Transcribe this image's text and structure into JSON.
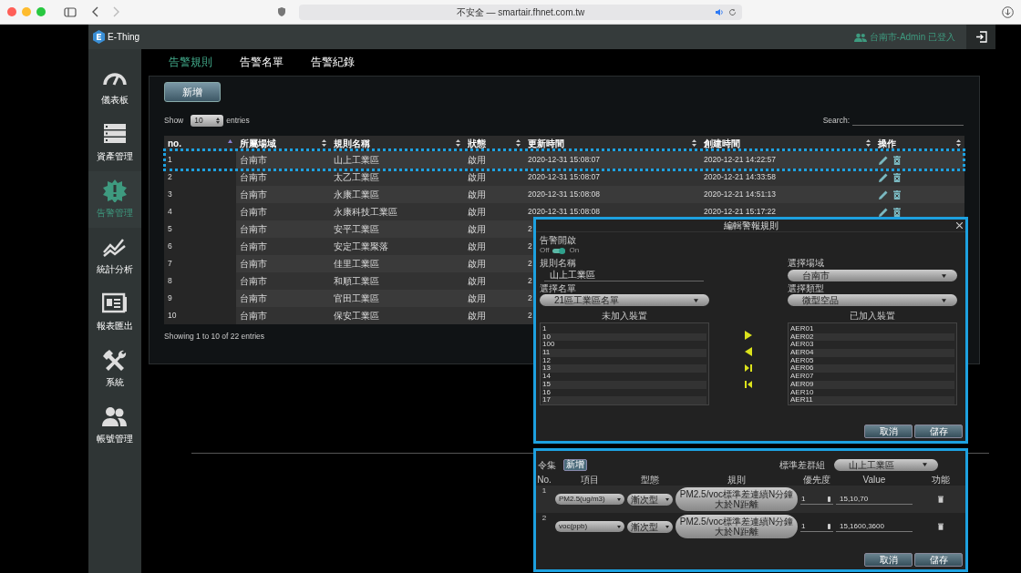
{
  "browser": {
    "url": "不安全 — smartair.fhnet.com.tw"
  },
  "header": {
    "logo": "E-Thing",
    "user": "台南市-Admin 已登入"
  },
  "sidebar": {
    "items": [
      {
        "label": "儀表板",
        "selected": false
      },
      {
        "label": "資產管理",
        "selected": false
      },
      {
        "label": "告警管理",
        "selected": true
      },
      {
        "label": "統計分析",
        "selected": false
      },
      {
        "label": "報表匯出",
        "selected": false
      },
      {
        "label": "系統",
        "selected": false
      },
      {
        "label": "帳號管理",
        "selected": false
      }
    ]
  },
  "tabs": [
    {
      "label": "告警規則",
      "selected": true
    },
    {
      "label": "告警名單",
      "selected": false
    },
    {
      "label": "告警紀錄",
      "selected": false
    }
  ],
  "toolbar": {
    "add_button": "新增",
    "show_label": "Show",
    "page_size": "10",
    "entries_label": "entries",
    "search_label": "Search:"
  },
  "table": {
    "columns": [
      {
        "label": "no.",
        "sorted": true
      },
      {
        "label": "所屬場域",
        "sorted": false
      },
      {
        "label": "規則名稱",
        "sorted": false
      },
      {
        "label": "狀態",
        "sorted": false
      },
      {
        "label": "更新時間",
        "sorted": false
      },
      {
        "label": "創建時間",
        "sorted": false
      },
      {
        "label": "操作",
        "sorted": false
      }
    ],
    "rows": [
      {
        "cells": [
          "1",
          "台南市",
          "山上工業區",
          "啟用",
          "2020-12-31 15:08:07",
          "2020-12-21 14:22:57"
        ]
      },
      {
        "cells": [
          "2",
          "台南市",
          "太乙工業區",
          "啟用",
          "2020-12-31 15:08:07",
          "2020-12-21 14:33:58"
        ]
      },
      {
        "cells": [
          "3",
          "台南市",
          "永康工業區",
          "啟用",
          "2020-12-31 15:08:08",
          "2020-12-21 14:51:13"
        ]
      },
      {
        "cells": [
          "4",
          "台南市",
          "永康科技工業區",
          "啟用",
          "2020-12-31 15:08:08",
          "2020-12-21 15:17:22"
        ]
      },
      {
        "cells": [
          "5",
          "台南市",
          "安平工業區",
          "啟用",
          "2"
        ]
      },
      {
        "cells": [
          "6",
          "台南市",
          "安定工業聚落",
          "啟用",
          "2"
        ]
      },
      {
        "cells": [
          "7",
          "台南市",
          "佳里工業區",
          "啟用",
          "2"
        ]
      },
      {
        "cells": [
          "8",
          "台南市",
          "和順工業區",
          "啟用",
          "2"
        ]
      },
      {
        "cells": [
          "9",
          "台南市",
          "官田工業區",
          "啟用",
          "2"
        ]
      },
      {
        "cells": [
          "10",
          "台南市",
          "保安工業區",
          "啟用",
          "2"
        ]
      }
    ],
    "info": "Showing 1 to 10 of 22 entries"
  },
  "modal": {
    "title": "編輯警報規則",
    "toggle_label": "告警開啟",
    "toggle_off": "Off",
    "toggle_on": "On",
    "toggle": true,
    "name_label": "規則名稱",
    "name_value": "山上工業區",
    "list_label": "選擇名單",
    "list_value": "21區工業區名單",
    "area_label": "選擇場域",
    "area_value": "台南市",
    "type_label": "選擇類型",
    "type_value": "微型空品",
    "available_title": "未加入裝置",
    "available": [
      "1",
      "10",
      "100",
      "11",
      "12",
      "13",
      "14",
      "15",
      "16",
      "17"
    ],
    "added_title": "已加入裝置",
    "added": [
      "AER01",
      "AER02",
      "AER03",
      "AER04",
      "AER05",
      "AER06",
      "AER07",
      "AER09",
      "AER10",
      "AER11"
    ],
    "buttons": [
      "取消",
      "儲存"
    ]
  },
  "rule_panel": {
    "label": "令集",
    "add_button": "新增",
    "group_label": "標準差群組",
    "group_value": "山上工業區",
    "columns": [
      "No.",
      "項目",
      "型態",
      "規則",
      "優先度",
      "Value",
      "功能"
    ],
    "rows": [
      {
        "no": "1",
        "item": "PM2.5(ug/m3)",
        "type": "漸次型",
        "rule": "PM2.5/voc標準差連續N分鐘大於N距離",
        "priority": "1",
        "value": "15,10,70"
      },
      {
        "no": "2",
        "item": "voc(ppb)",
        "type": "漸次型",
        "rule": "PM2.5/voc標準差連續N分鐘大於N距離",
        "priority": "1",
        "value": "15,1600,3600"
      }
    ],
    "buttons": [
      "取消",
      "儲存"
    ]
  }
}
